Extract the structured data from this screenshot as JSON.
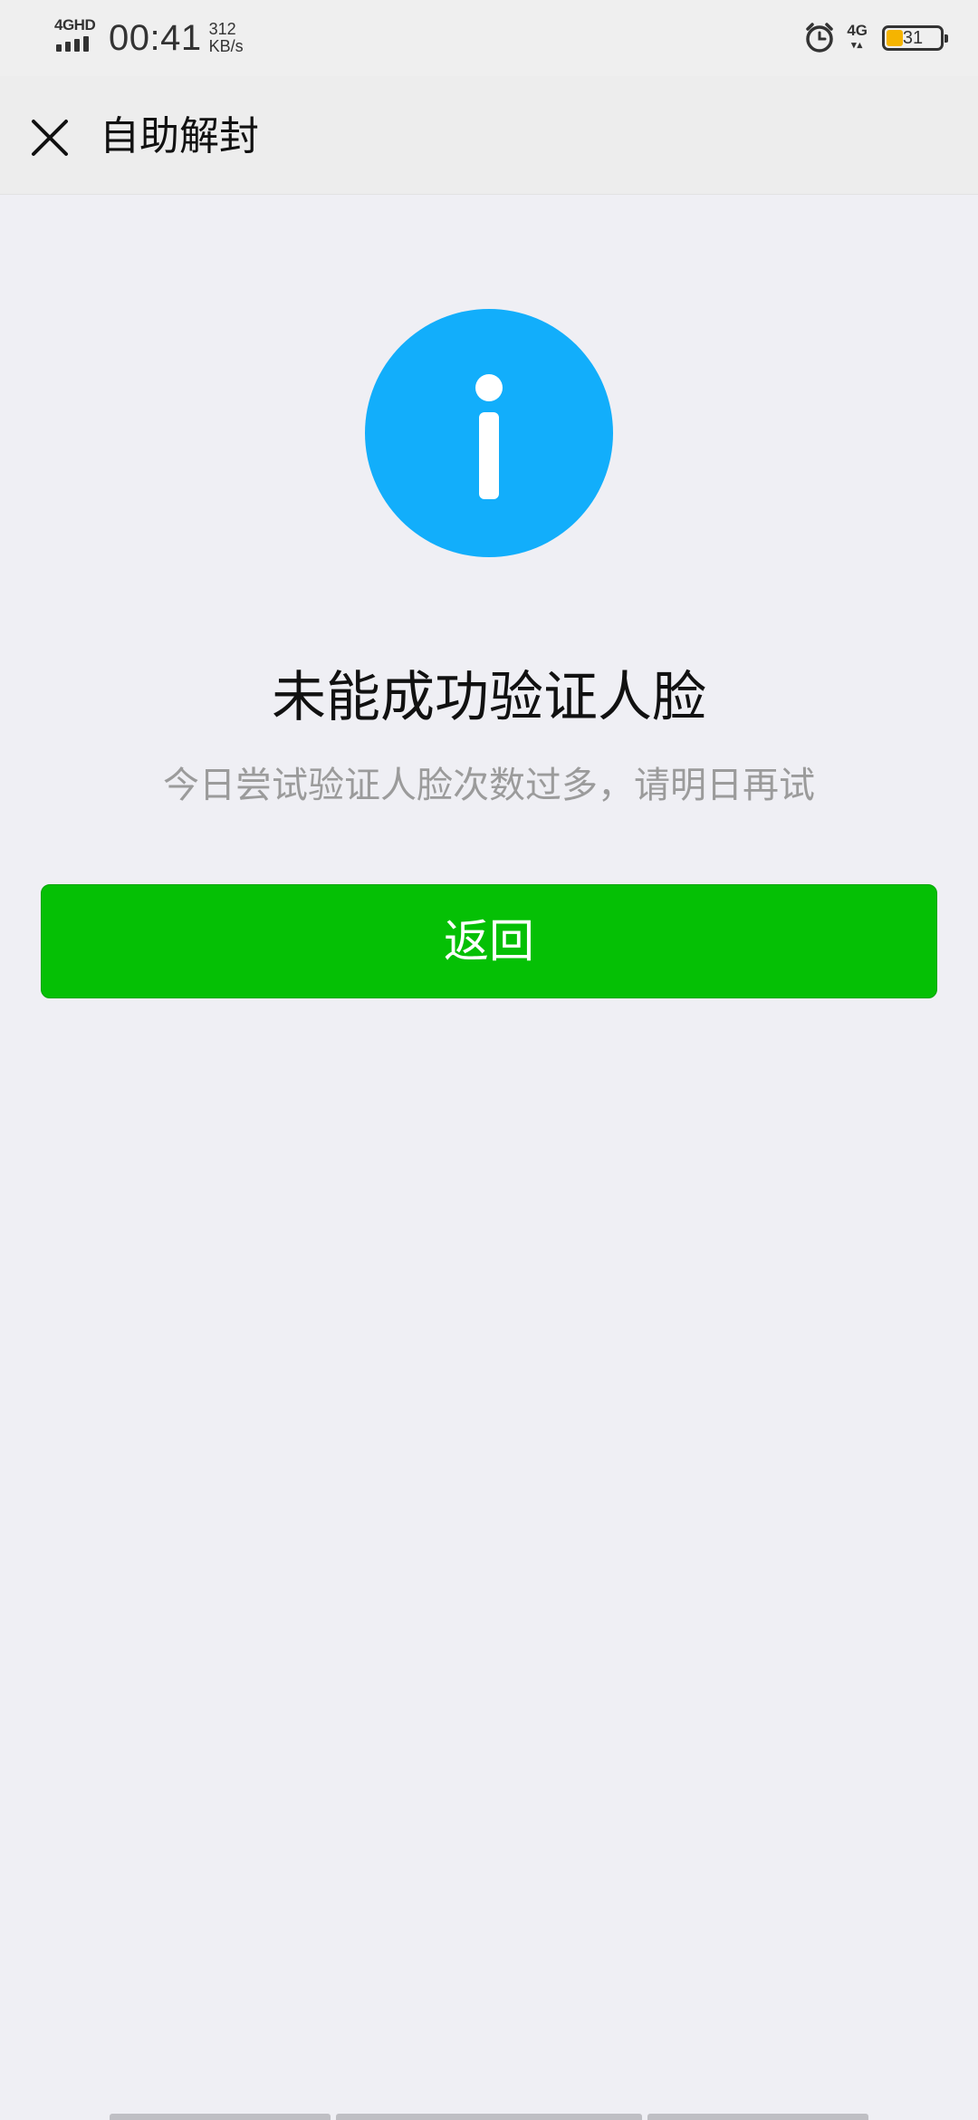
{
  "status_bar": {
    "network": "4GHD",
    "time": "00:41",
    "speed_value": "312",
    "speed_unit": "KB/s",
    "network_right": "4G",
    "battery_level": 31,
    "battery_text": "31",
    "battery_color": "#f5b400"
  },
  "nav": {
    "close_icon": "close-icon",
    "title": "自助解封"
  },
  "result": {
    "icon": "info-icon",
    "icon_color": "#12aefb",
    "title": "未能成功验证人脸",
    "description": "今日尝试验证人脸次数过多，请明日再试"
  },
  "actions": {
    "back_label": "返回",
    "back_color": "#05c005"
  }
}
